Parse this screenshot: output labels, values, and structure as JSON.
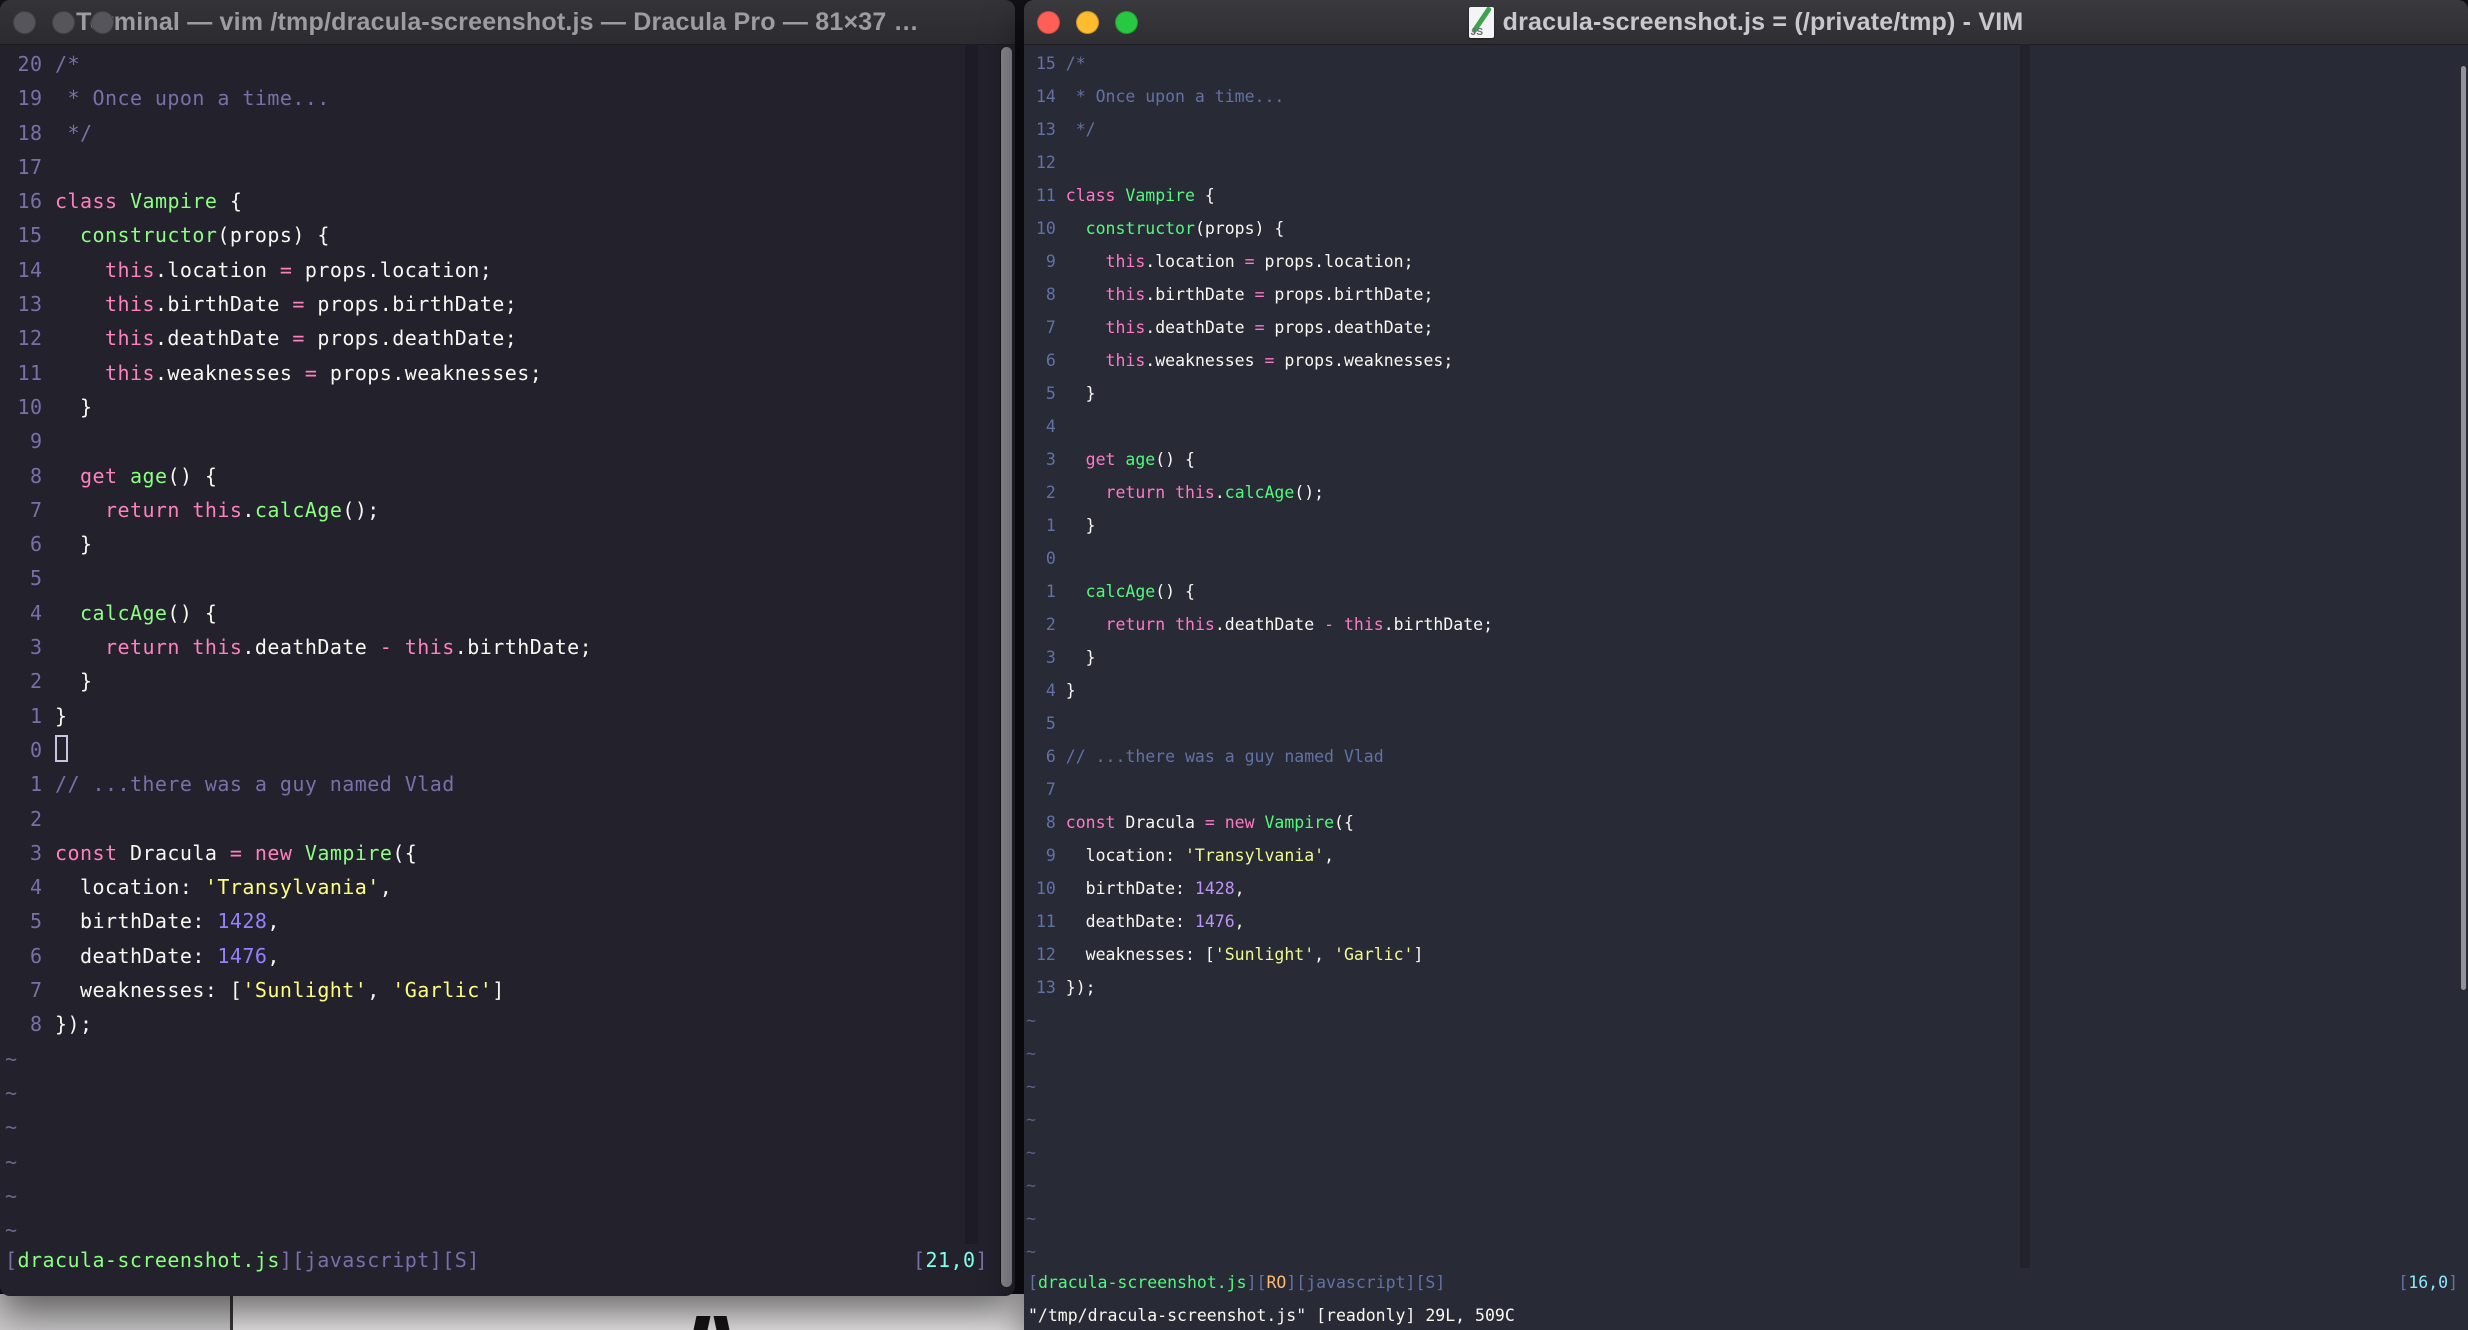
{
  "palette": {
    "left_bg": "#22212c",
    "right_bg": "#282a36",
    "foreground": "#f8f8f2",
    "left": {
      "comment": "#7970a9",
      "pink": "#ff80bf",
      "green": "#8aff80",
      "purple": "#9580ff",
      "yellow": "#ffff80",
      "cyan": "#80ffea"
    },
    "right": {
      "comment": "#6272a4",
      "pink": "#ff79c6",
      "green": "#50fa7b",
      "purple": "#bd93f9",
      "yellow": "#f1f a8c",
      "cyan": "#8be9fd",
      "orange": "#ffb86c"
    },
    "traffic_red": "#ff5f57",
    "traffic_yellow": "#febc2e",
    "traffic_green": "#28c840"
  },
  "left_window": {
    "title": "Terminal — vim /tmp/dracula-screenshot.js — Dracula Pro — 81×37 —...",
    "traffic_lights_state": "inactive",
    "lines": [
      {
        "n": "20",
        "toks": [
          [
            "comment",
            "/*"
          ]
        ]
      },
      {
        "n": "19",
        "toks": [
          [
            "comment",
            " * Once upon a time..."
          ]
        ]
      },
      {
        "n": "18",
        "toks": [
          [
            "comment",
            " */"
          ]
        ]
      },
      {
        "n": "17",
        "toks": []
      },
      {
        "n": "16",
        "toks": [
          [
            "pink",
            "class"
          ],
          [
            "fg",
            " "
          ],
          [
            "green",
            "Vampire"
          ],
          [
            "fg",
            " {"
          ]
        ]
      },
      {
        "n": "15",
        "toks": [
          [
            "fg",
            "  "
          ],
          [
            "green",
            "constructor"
          ],
          [
            "fg",
            "(props) {"
          ]
        ]
      },
      {
        "n": "14",
        "toks": [
          [
            "fg",
            "    "
          ],
          [
            "pink",
            "this"
          ],
          [
            "fg",
            ".location "
          ],
          [
            "pink",
            "="
          ],
          [
            "fg",
            " props.location;"
          ]
        ]
      },
      {
        "n": "13",
        "toks": [
          [
            "fg",
            "    "
          ],
          [
            "pink",
            "this"
          ],
          [
            "fg",
            ".birthDate "
          ],
          [
            "pink",
            "="
          ],
          [
            "fg",
            " props.birthDate;"
          ]
        ]
      },
      {
        "n": "12",
        "toks": [
          [
            "fg",
            "    "
          ],
          [
            "pink",
            "this"
          ],
          [
            "fg",
            ".deathDate "
          ],
          [
            "pink",
            "="
          ],
          [
            "fg",
            " props.deathDate;"
          ]
        ]
      },
      {
        "n": "11",
        "toks": [
          [
            "fg",
            "    "
          ],
          [
            "pink",
            "this"
          ],
          [
            "fg",
            ".weaknesses "
          ],
          [
            "pink",
            "="
          ],
          [
            "fg",
            " props.weaknesses;"
          ]
        ]
      },
      {
        "n": "10",
        "toks": [
          [
            "fg",
            "  }"
          ]
        ]
      },
      {
        "n": "9",
        "toks": []
      },
      {
        "n": "8",
        "toks": [
          [
            "fg",
            "  "
          ],
          [
            "pink",
            "get"
          ],
          [
            "fg",
            " "
          ],
          [
            "green",
            "age"
          ],
          [
            "fg",
            "() {"
          ]
        ]
      },
      {
        "n": "7",
        "toks": [
          [
            "fg",
            "    "
          ],
          [
            "pink",
            "return"
          ],
          [
            "fg",
            " "
          ],
          [
            "pink",
            "this"
          ],
          [
            "fg",
            "."
          ],
          [
            "green",
            "calcAge"
          ],
          [
            "fg",
            "();"
          ]
        ]
      },
      {
        "n": "6",
        "toks": [
          [
            "fg",
            "  }"
          ]
        ]
      },
      {
        "n": "5",
        "toks": []
      },
      {
        "n": "4",
        "toks": [
          [
            "fg",
            "  "
          ],
          [
            "green",
            "calcAge"
          ],
          [
            "fg",
            "() {"
          ]
        ]
      },
      {
        "n": "3",
        "toks": [
          [
            "fg",
            "    "
          ],
          [
            "pink",
            "return"
          ],
          [
            "fg",
            " "
          ],
          [
            "pink",
            "this"
          ],
          [
            "fg",
            ".deathDate "
          ],
          [
            "pink",
            "-"
          ],
          [
            "fg",
            " "
          ],
          [
            "pink",
            "this"
          ],
          [
            "fg",
            ".birthDate;"
          ]
        ]
      },
      {
        "n": "2",
        "toks": [
          [
            "fg",
            "  }"
          ]
        ]
      },
      {
        "n": "1",
        "toks": [
          [
            "fg",
            "}"
          ]
        ]
      },
      {
        "n": "0",
        "cursor": true,
        "toks": []
      },
      {
        "n": "1",
        "toks": [
          [
            "comment",
            "// ...there was a guy named Vlad"
          ]
        ]
      },
      {
        "n": "2",
        "toks": []
      },
      {
        "n": "3",
        "toks": [
          [
            "pink",
            "const"
          ],
          [
            "fg",
            " Dracula "
          ],
          [
            "pink",
            "="
          ],
          [
            "fg",
            " "
          ],
          [
            "pink",
            "new"
          ],
          [
            "fg",
            " "
          ],
          [
            "green",
            "Vampire"
          ],
          [
            "fg",
            "({"
          ]
        ]
      },
      {
        "n": "4",
        "toks": [
          [
            "fg",
            "  location: "
          ],
          [
            "yellow",
            "'Transylvania'"
          ],
          [
            "fg",
            ","
          ]
        ]
      },
      {
        "n": "5",
        "toks": [
          [
            "fg",
            "  birthDate: "
          ],
          [
            "purple",
            "1428"
          ],
          [
            "fg",
            ","
          ]
        ]
      },
      {
        "n": "6",
        "toks": [
          [
            "fg",
            "  deathDate: "
          ],
          [
            "purple",
            "1476"
          ],
          [
            "fg",
            ","
          ]
        ]
      },
      {
        "n": "7",
        "toks": [
          [
            "fg",
            "  weaknesses: ["
          ],
          [
            "yellow",
            "'Sunlight'"
          ],
          [
            "fg",
            ", "
          ],
          [
            "yellow",
            "'Garlic'"
          ],
          [
            "fg",
            "]"
          ]
        ]
      },
      {
        "n": "8",
        "toks": [
          [
            "fg",
            "});"
          ]
        ]
      },
      {
        "tilde": "~"
      },
      {
        "tilde": "~"
      },
      {
        "tilde": "~"
      },
      {
        "tilde": "~"
      },
      {
        "tilde": "~"
      },
      {
        "tilde": "~"
      }
    ],
    "statusline": [
      [
        "comment",
        "["
      ],
      [
        "green",
        "dracula-screenshot.js"
      ],
      [
        "comment",
        "]["
      ],
      [
        "comment",
        "javascript"
      ],
      [
        "comment",
        "]["
      ],
      [
        "comment",
        "S"
      ],
      [
        "comment",
        "]"
      ]
    ],
    "ruler": [
      [
        "comment",
        "["
      ],
      [
        "cyan",
        "21,0"
      ],
      [
        "comment",
        "]"
      ]
    ]
  },
  "right_window": {
    "title": "dracula-screenshot.js = (/private/tmp) - VIM",
    "icon_label": "JS",
    "traffic_lights_state": "active",
    "lines": [
      {
        "n": "15",
        "toks": [
          [
            "comment",
            "/*"
          ]
        ]
      },
      {
        "n": "14",
        "toks": [
          [
            "comment",
            " * Once upon a time..."
          ]
        ]
      },
      {
        "n": "13",
        "toks": [
          [
            "comment",
            " */"
          ]
        ]
      },
      {
        "n": "12",
        "toks": []
      },
      {
        "n": "11",
        "toks": [
          [
            "pink",
            "class"
          ],
          [
            "fg",
            " "
          ],
          [
            "green",
            "Vampire"
          ],
          [
            "fg",
            " {"
          ]
        ]
      },
      {
        "n": "10",
        "toks": [
          [
            "fg",
            "  "
          ],
          [
            "green",
            "constructor"
          ],
          [
            "fg",
            "(props) {"
          ]
        ]
      },
      {
        "n": "9",
        "toks": [
          [
            "fg",
            "    "
          ],
          [
            "pink",
            "this"
          ],
          [
            "fg",
            ".location "
          ],
          [
            "pink",
            "="
          ],
          [
            "fg",
            " props.location;"
          ]
        ]
      },
      {
        "n": "8",
        "toks": [
          [
            "fg",
            "    "
          ],
          [
            "pink",
            "this"
          ],
          [
            "fg",
            ".birthDate "
          ],
          [
            "pink",
            "="
          ],
          [
            "fg",
            " props.birthDate;"
          ]
        ]
      },
      {
        "n": "7",
        "toks": [
          [
            "fg",
            "    "
          ],
          [
            "pink",
            "this"
          ],
          [
            "fg",
            ".deathDate "
          ],
          [
            "pink",
            "="
          ],
          [
            "fg",
            " props.deathDate;"
          ]
        ]
      },
      {
        "n": "6",
        "toks": [
          [
            "fg",
            "    "
          ],
          [
            "pink",
            "this"
          ],
          [
            "fg",
            ".weaknesses "
          ],
          [
            "pink",
            "="
          ],
          [
            "fg",
            " props.weaknesses;"
          ]
        ]
      },
      {
        "n": "5",
        "toks": [
          [
            "fg",
            "  }"
          ]
        ]
      },
      {
        "n": "4",
        "toks": []
      },
      {
        "n": "3",
        "toks": [
          [
            "fg",
            "  "
          ],
          [
            "pink",
            "get"
          ],
          [
            "fg",
            " "
          ],
          [
            "green",
            "age"
          ],
          [
            "fg",
            "() {"
          ]
        ]
      },
      {
        "n": "2",
        "toks": [
          [
            "fg",
            "    "
          ],
          [
            "pink",
            "return"
          ],
          [
            "fg",
            " "
          ],
          [
            "pink",
            "this"
          ],
          [
            "fg",
            "."
          ],
          [
            "green",
            "calcAge"
          ],
          [
            "fg",
            "();"
          ]
        ]
      },
      {
        "n": "1",
        "toks": [
          [
            "fg",
            "  }"
          ]
        ]
      },
      {
        "n": "0",
        "toks": []
      },
      {
        "n": "1",
        "toks": [
          [
            "fg",
            "  "
          ],
          [
            "green",
            "calcAge"
          ],
          [
            "fg",
            "() {"
          ]
        ]
      },
      {
        "n": "2",
        "toks": [
          [
            "fg",
            "    "
          ],
          [
            "pink",
            "return"
          ],
          [
            "fg",
            " "
          ],
          [
            "pink",
            "this"
          ],
          [
            "fg",
            ".deathDate "
          ],
          [
            "pink",
            "-"
          ],
          [
            "fg",
            " "
          ],
          [
            "pink",
            "this"
          ],
          [
            "fg",
            ".birthDate;"
          ]
        ]
      },
      {
        "n": "3",
        "toks": [
          [
            "fg",
            "  }"
          ]
        ]
      },
      {
        "n": "4",
        "toks": [
          [
            "fg",
            "}"
          ]
        ]
      },
      {
        "n": "5",
        "toks": []
      },
      {
        "n": "6",
        "toks": [
          [
            "comment",
            "// ...there was a guy named Vlad"
          ]
        ]
      },
      {
        "n": "7",
        "toks": []
      },
      {
        "n": "8",
        "toks": [
          [
            "pink",
            "const"
          ],
          [
            "fg",
            " Dracula "
          ],
          [
            "pink",
            "="
          ],
          [
            "fg",
            " "
          ],
          [
            "pink",
            "new"
          ],
          [
            "fg",
            " "
          ],
          [
            "green",
            "Vampire"
          ],
          [
            "fg",
            "({"
          ]
        ]
      },
      {
        "n": "9",
        "toks": [
          [
            "fg",
            "  location: "
          ],
          [
            "yellow",
            "'Transylvania'"
          ],
          [
            "fg",
            ","
          ]
        ]
      },
      {
        "n": "10",
        "toks": [
          [
            "fg",
            "  birthDate: "
          ],
          [
            "purple",
            "1428"
          ],
          [
            "fg",
            ","
          ]
        ]
      },
      {
        "n": "11",
        "toks": [
          [
            "fg",
            "  deathDate: "
          ],
          [
            "purple",
            "1476"
          ],
          [
            "fg",
            ","
          ]
        ]
      },
      {
        "n": "12",
        "toks": [
          [
            "fg",
            "  weaknesses: ["
          ],
          [
            "yellow",
            "'Sunlight'"
          ],
          [
            "fg",
            ", "
          ],
          [
            "yellow",
            "'Garlic'"
          ],
          [
            "fg",
            "]"
          ]
        ]
      },
      {
        "n": "13",
        "toks": [
          [
            "fg",
            "});"
          ]
        ]
      },
      {
        "tilde": "~"
      },
      {
        "tilde": "~"
      },
      {
        "tilde": "~"
      },
      {
        "tilde": "~"
      },
      {
        "tilde": "~"
      },
      {
        "tilde": "~"
      },
      {
        "tilde": "~"
      },
      {
        "tilde": "~"
      }
    ],
    "statusline": [
      [
        "comment",
        "["
      ],
      [
        "green",
        "dracula-screenshot.js"
      ],
      [
        "comment",
        "]["
      ],
      [
        "orange",
        "RO"
      ],
      [
        "comment",
        "]["
      ],
      [
        "comment",
        "javascript"
      ],
      [
        "comment",
        "]["
      ],
      [
        "comment",
        "S"
      ],
      [
        "comment",
        "]"
      ]
    ],
    "ruler": [
      [
        "comment",
        "["
      ],
      [
        "cyan",
        "16,0"
      ],
      [
        "comment",
        "]"
      ]
    ],
    "command_line": "\"/tmp/dracula-screenshot.js\" [readonly] 29L, 509C"
  }
}
